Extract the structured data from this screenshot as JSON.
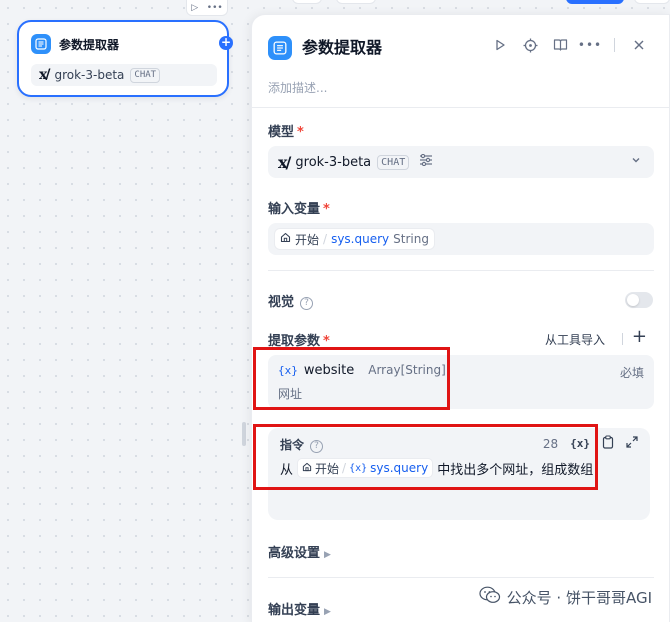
{
  "node": {
    "title": "参数提取器",
    "model_name": "grok-3-beta",
    "model_tag": "CHAT",
    "handle": "+",
    "toolbar_more": "•••"
  },
  "panel": {
    "title": "参数提取器",
    "description_placeholder": "添加描述...",
    "model": {
      "label": "模型",
      "required_mark": "*",
      "name": "grok-3-beta",
      "tag": "CHAT"
    },
    "input_vars": {
      "label": "输入变量",
      "required_mark": "*",
      "source": "开始",
      "variable": "sys.query",
      "type": "String"
    },
    "vision": {
      "label": "视觉",
      "help": "?",
      "enabled": false
    },
    "extract_params": {
      "label": "提取参数",
      "required_mark": "*",
      "import_label": "从工具导入",
      "add_label": "+",
      "items": [
        {
          "var_icon": "{x}",
          "name": "website",
          "type": "Array[String]",
          "required_label": "必填",
          "description": "网址"
        }
      ]
    },
    "instruction": {
      "label": "指令",
      "help": "?",
      "count": "28",
      "var_button": "{x}",
      "prefix": "从",
      "source": "开始",
      "var_icon": "{x}",
      "variable": "sys.query",
      "suffix": "中找出多个网址，组成数组"
    },
    "advanced": {
      "label": "高级设置"
    },
    "output_vars": {
      "label": "输出变量"
    }
  },
  "watermark": {
    "text": "公众号 · 饼干哥哥AGI"
  },
  "colors": {
    "accent": "#155eef",
    "node_border": "#2970ff",
    "icon_bg": "#2e90fa",
    "annotation_red": "#e01414"
  }
}
